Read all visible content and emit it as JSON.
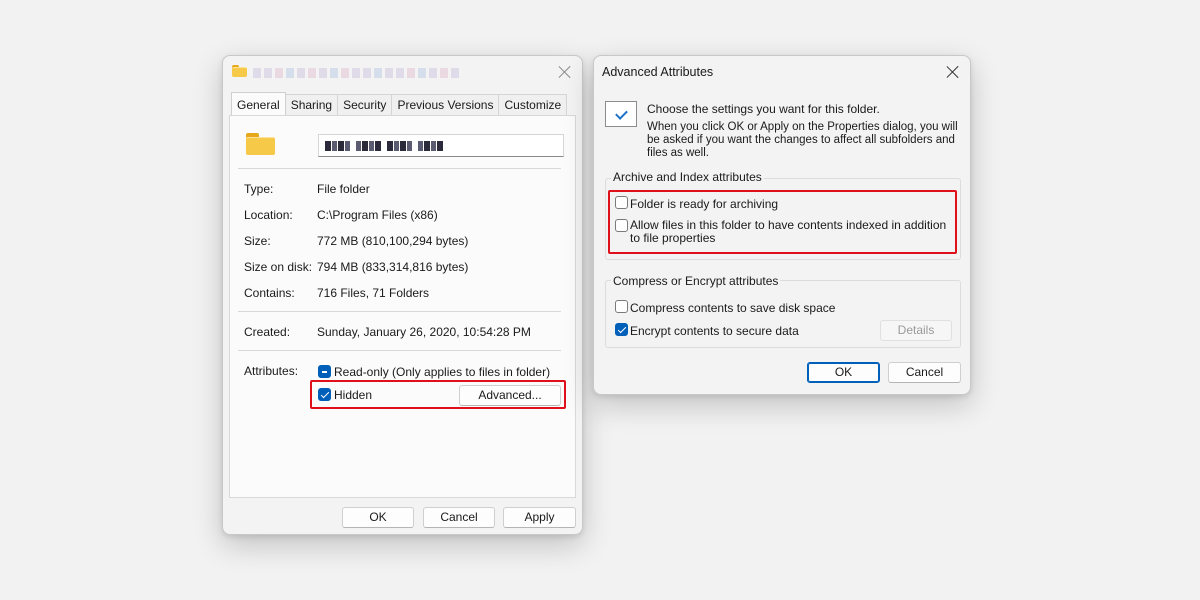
{
  "properties": {
    "tabs": [
      "General",
      "Sharing",
      "Security",
      "Previous Versions",
      "Customize"
    ],
    "details": [
      {
        "label": "Type:",
        "value": "File folder"
      },
      {
        "label": "Location:",
        "value": "C:\\Program Files (x86)"
      },
      {
        "label": "Size:",
        "value": "772 MB (810,100,294 bytes)"
      },
      {
        "label": "Size on disk:",
        "value": "794 MB (833,314,816 bytes)"
      },
      {
        "label": "Contains:",
        "value": "716 Files, 71 Folders"
      }
    ],
    "created": {
      "label": "Created:",
      "value": "Sunday, January 26, 2020, 10:54:28 PM"
    },
    "attributes": {
      "label": "Attributes:",
      "readonly_label": "Read-only (Only applies to files in folder)",
      "readonly_state": "indeterminate",
      "hidden_label": "Hidden",
      "hidden_checked": true,
      "advanced_button": "Advanced..."
    },
    "buttons": {
      "ok": "OK",
      "cancel": "Cancel",
      "apply": "Apply"
    }
  },
  "advanced": {
    "title": "Advanced Attributes",
    "intro": "Choose the settings you want for this folder.",
    "intro_detail": "When you click OK or Apply on the Properties dialog, you will be asked if you want the changes to affect all subfolders and files as well.",
    "archive_group": {
      "title": "Archive and Index attributes",
      "archiving_label": "Folder is ready for archiving",
      "archiving_checked": false,
      "indexing_label": "Allow files in this folder to have contents indexed in addition to file properties",
      "indexing_checked": false
    },
    "compress_group": {
      "title": "Compress or Encrypt attributes",
      "compress_label": "Compress contents to save disk space",
      "compress_checked": false,
      "encrypt_label": "Encrypt contents to secure data",
      "encrypt_checked": true,
      "details_button": "Details"
    },
    "buttons": {
      "ok": "OK",
      "cancel": "Cancel"
    }
  },
  "colors": {
    "accent": "#005fb8",
    "highlight": "#e0101a",
    "folder": "#f7c948"
  },
  "icons": [
    "folder-icon",
    "close-icon",
    "checkmark-icon"
  ]
}
